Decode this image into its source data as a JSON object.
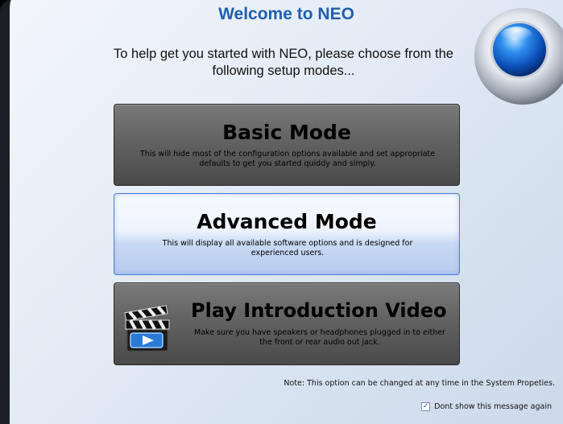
{
  "dialog": {
    "title": "Welcome to NEO",
    "subtitle": "To help get you started with NEO, please choose from the following setup modes..."
  },
  "modes": [
    {
      "title": "Basic Mode",
      "description": "This will hide most of the configuration options available and set appropriate defaults to get you started quiddy and simply."
    },
    {
      "title": "Advanced Mode",
      "description": "This will display all available software options and is designed for experienced users."
    },
    {
      "title": "Play Introduction Video",
      "description": "Make sure you have speakers or headphones plugged in to either the front or rear audio out jack."
    }
  ],
  "footer": {
    "note": "Note: This option can be changed at any time in the System Propeties.",
    "checkbox_label": "Dont show this message again",
    "checkbox_checked": true
  },
  "colors": {
    "accent": "#1f5fae",
    "selected_border": "#4a7fd8"
  },
  "icons": {
    "logo": "neo-orb-logo",
    "video": "clapperboard-play-icon"
  }
}
